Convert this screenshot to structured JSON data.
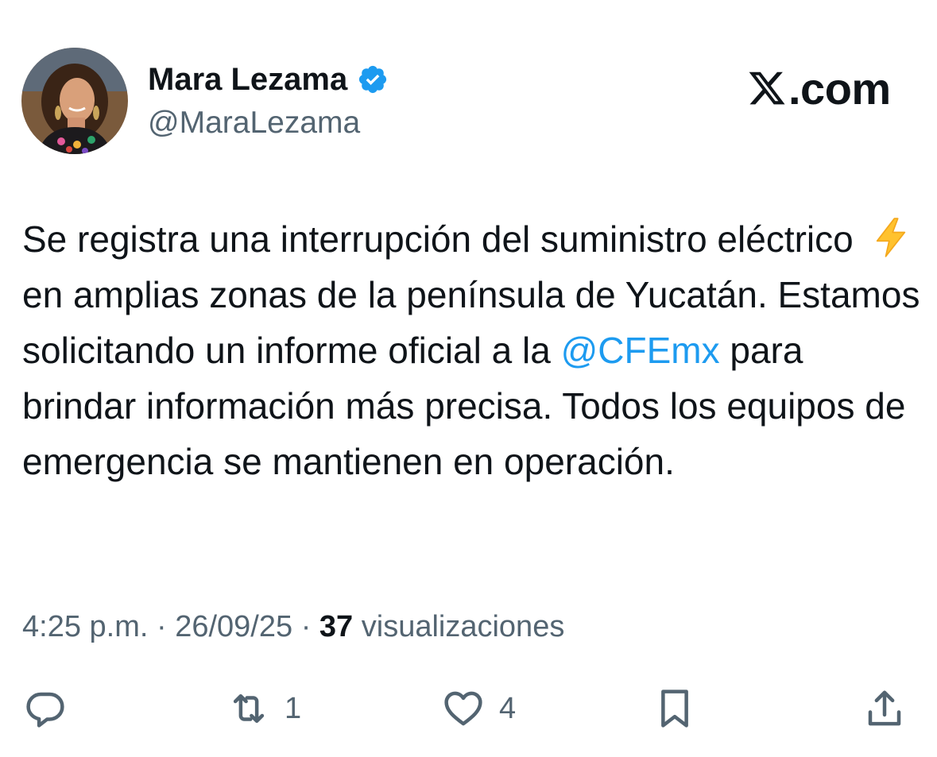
{
  "author": {
    "display_name": "Mara Lezama",
    "handle": "@MaraLezama",
    "verified": true
  },
  "watermark": {
    "text": ".com",
    "logo_icon": "x-logo-icon"
  },
  "tweet": {
    "text_before_emoji": "Se registra una interrupción del suministro eléctrico",
    "emoji": "⚡",
    "text_after_emoji": "en amplias zonas de la península de Yucatán. Estamos solicitando un informe oficial a la",
    "mention": "@CFEmx",
    "text_after_mention": "para brindar información más precisa. Todos los equipos de emergencia se mantienen en operación."
  },
  "meta": {
    "time": "4:25 p.m.",
    "separator": "·",
    "date": "26/09/25",
    "views_count": "37",
    "views_label": "visualizaciones"
  },
  "actions": {
    "reply_count": "",
    "retweet_count": "1",
    "like_count": "4"
  },
  "colors": {
    "text": "#0f1419",
    "secondary": "#536471",
    "accent": "#1d9bf0"
  }
}
